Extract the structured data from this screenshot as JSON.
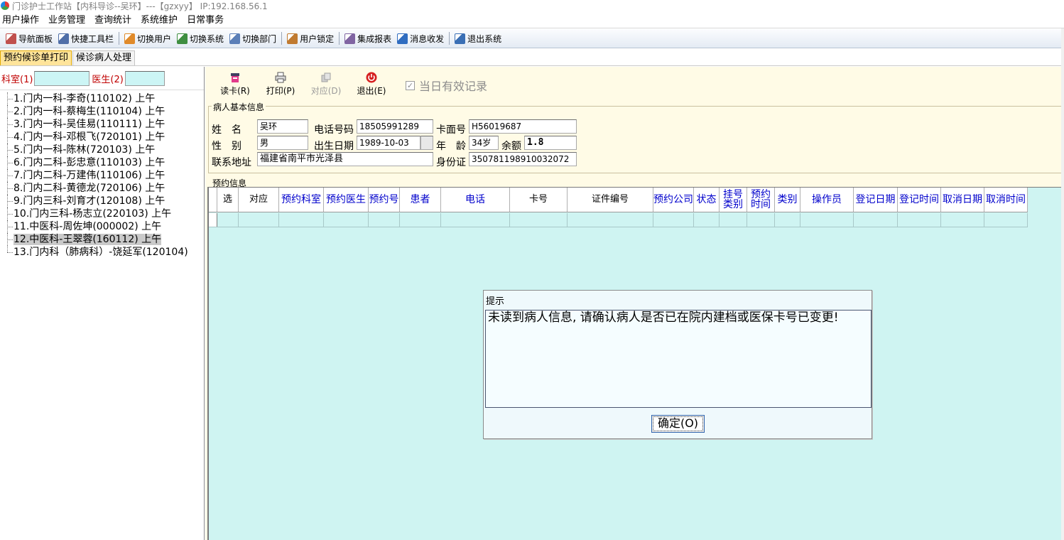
{
  "window": {
    "title": "门诊护士工作站【内科导诊--吴环】---【gzxyy】 IP:192.168.56.1"
  },
  "menu": [
    "用户操作",
    "业务管理",
    "查询统计",
    "系统维护",
    "日常事务"
  ],
  "toolbar": [
    {
      "label": "导航面板",
      "icon": "navigation-panel-icon",
      "color": "#c0504d"
    },
    {
      "label": "快捷工具栏",
      "icon": "shortcut-toolbar-icon",
      "color": "#4f6ea8"
    },
    {
      "label": "切换用户",
      "icon": "switch-user-icon",
      "color": "#e08a2a"
    },
    {
      "label": "切换系统",
      "icon": "switch-system-icon",
      "color": "#3e8e41"
    },
    {
      "label": "切换部门",
      "icon": "switch-department-icon",
      "color": "#5b7fb8"
    },
    {
      "label": "用户锁定",
      "icon": "user-lock-icon",
      "color": "#c07a30"
    },
    {
      "label": "集成报表",
      "icon": "report-icon",
      "color": "#8064a2"
    },
    {
      "label": "消息收发",
      "icon": "message-icon",
      "color": "#2f6cc0"
    },
    {
      "label": "退出系统",
      "icon": "exit-system-icon",
      "color": "#3a6fb5"
    }
  ],
  "tabs": [
    {
      "label": "预约候诊单打印",
      "active": true
    },
    {
      "label": "候诊病人处理",
      "active": false
    }
  ],
  "filters": {
    "dept_label": "科室(1)",
    "doctor_label": "医生(2)",
    "dept_value": "",
    "doctor_value": ""
  },
  "doctor_list": [
    "1.门内一科-李奇(110102) 上午",
    "2.门内一科-蔡梅生(110104) 上午",
    "3.门内一科-吴佳易(110111) 上午",
    "4.门内一科-邓根飞(720101) 上午",
    "5.门内一科-陈林(720103) 上午",
    "6.门内二科-彭忠意(110103) 上午",
    "7.门内二科-万建伟(110106) 上午",
    "8.门内二科-黄德龙(720106) 上午",
    "9.门内三科-刘育才(120108) 上午",
    "10.门内三科-杨志立(220103) 上午",
    "11.中医科-周佐坤(000002) 上午",
    "12.中医科-王翠蓉(160112) 上午",
    "13.门内科（肺病科）-饶延军(120104)"
  ],
  "selected_doctor_index": 11,
  "actions": {
    "read_card": "读卡(R)",
    "print": "打印(P)",
    "match": "对应(D)",
    "exit": "退出(E)",
    "today_valid": "当日有效记录",
    "today_valid_checked": true
  },
  "patient": {
    "section_title": "病人基本信息",
    "name_label": "姓　名",
    "name": "吴环",
    "phone_label": "电话号码",
    "phone": "18505991289",
    "card_label": "卡面号",
    "card": "H56019687",
    "gender_label": "性　别",
    "gender": "男",
    "birth_label": "出生日期",
    "birth": "1989-10-03",
    "age_label": "年　龄",
    "age": "34岁",
    "balance_label": "余额",
    "balance": "1.8",
    "address_label": "联系地址",
    "address": "福建省南平市光泽县",
    "id_label": "身份证",
    "id_number": "350781198910032072"
  },
  "appointments": {
    "section_title": "预约信息",
    "columns": [
      {
        "label": "选",
        "blue": false
      },
      {
        "label": "对应",
        "blue": false
      },
      {
        "label": "预约科室",
        "blue": true
      },
      {
        "label": "预约医生",
        "blue": true
      },
      {
        "label": "预约号",
        "blue": true
      },
      {
        "label": "患者",
        "blue": true
      },
      {
        "label": "电话",
        "blue": true
      },
      {
        "label": "卡号",
        "blue": false
      },
      {
        "label": "证件编号",
        "blue": false
      },
      {
        "label": "预约公司",
        "blue": true
      },
      {
        "label": "状态",
        "blue": true
      },
      {
        "label": "挂号类别",
        "blue": true
      },
      {
        "label": "预约时间",
        "blue": true
      },
      {
        "label": "类别",
        "blue": true
      },
      {
        "label": "操作员",
        "blue": true
      },
      {
        "label": "登记日期",
        "blue": true
      },
      {
        "label": "登记时间",
        "blue": true
      },
      {
        "label": "取消日期",
        "blue": true
      },
      {
        "label": "取消时间",
        "blue": true
      }
    ],
    "rows": []
  },
  "dialog": {
    "title": "提示",
    "message": "未读到病人信息, 请确认病人是否已在院内建档或医保卡号已变更!",
    "ok_label": "确定(O)"
  }
}
